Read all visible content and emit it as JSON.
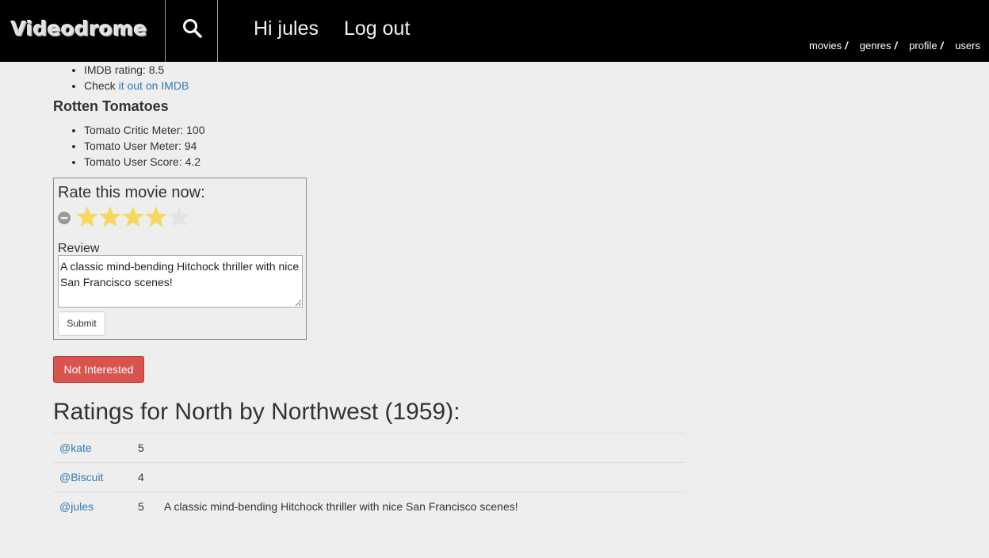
{
  "header": {
    "brand": "Videodrome",
    "greeting": "Hi jules",
    "logout": "Log out",
    "links": [
      {
        "label": "movies",
        "sep": "/"
      },
      {
        "label": "genres",
        "sep": "/"
      },
      {
        "label": "profile",
        "sep": "/"
      },
      {
        "label": "users",
        "sep": ""
      }
    ]
  },
  "imdb": {
    "rating_text": "IMDB rating: 8.5",
    "check_prefix": "Check ",
    "check_link": "it out on IMDB"
  },
  "rotten_tomatoes": {
    "title": "Rotten Tomatoes",
    "items": [
      "Tomato Critic Meter: 100",
      "Tomato User Meter: 94",
      "Tomato User Score: 4.2"
    ]
  },
  "rate_form": {
    "title": "Rate this movie now:",
    "stars_selected": 4,
    "stars_total": 5,
    "review_label": "Review",
    "review_value": "A classic mind-bending Hitchock thriller with nice San Francisco scenes!",
    "submit_label": "Submit",
    "colors": {
      "star_on": "#f6d860",
      "star_off": "#e3e3e3"
    }
  },
  "not_interested_label": "Not Interested",
  "ratings": {
    "heading": "Ratings for North by Northwest (1959):",
    "rows": [
      {
        "user": "@kate",
        "score": "5",
        "review": ""
      },
      {
        "user": "@Biscuit",
        "score": "4",
        "review": ""
      },
      {
        "user": "@jules",
        "score": "5",
        "review": "A classic mind-bending Hitchock thriller with nice San Francisco scenes!"
      }
    ]
  },
  "icons": {
    "search": "search-icon",
    "cancel": "cancel-rating-icon",
    "star": "star-icon"
  }
}
